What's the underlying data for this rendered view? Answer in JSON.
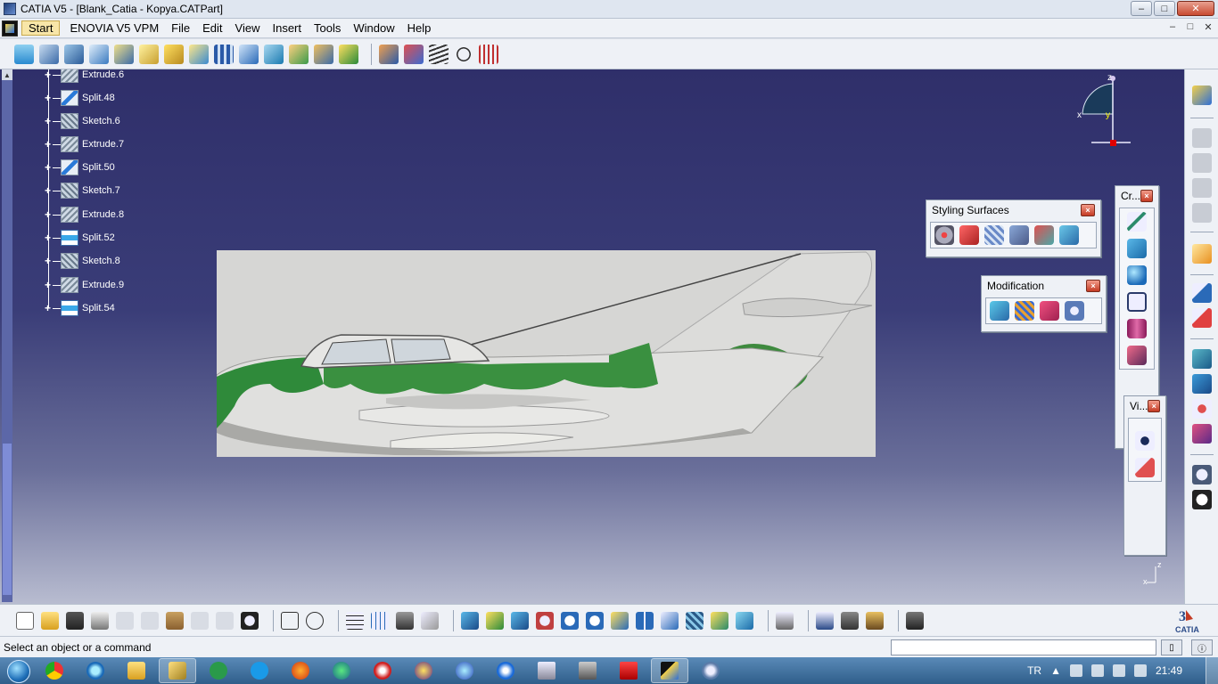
{
  "window": {
    "title": "CATIA V5 - [Blank_Catia - Kopya.CATPart]",
    "buttons": [
      "–",
      "□",
      "✕"
    ]
  },
  "menu": {
    "items": [
      "Start",
      "ENOVIA V5 VPM",
      "File",
      "Edit",
      "View",
      "Insert",
      "Tools",
      "Window",
      "Help"
    ],
    "mdi_buttons": [
      "–",
      "□",
      "✕"
    ]
  },
  "tree": {
    "items": [
      {
        "label": "Extrude.6",
        "icon": "extrude-icon"
      },
      {
        "label": "Split.48",
        "icon": "split-icon"
      },
      {
        "label": "Sketch.6",
        "icon": "sketch-icon"
      },
      {
        "label": "Extrude.7",
        "icon": "extrude-icon"
      },
      {
        "label": "Split.50",
        "icon": "split-icon"
      },
      {
        "label": "Sketch.7",
        "icon": "sketch-icon"
      },
      {
        "label": "Extrude.8",
        "icon": "extrude-icon"
      },
      {
        "label": "Split.52",
        "icon": "split-icon"
      },
      {
        "label": "Sketch.8",
        "icon": "sketch-icon"
      },
      {
        "label": "Extrude.9",
        "icon": "extrude-icon"
      },
      {
        "label": "Split.54",
        "icon": "split-icon"
      }
    ]
  },
  "compass": {
    "z_label": "z",
    "x_label": "x",
    "y_label": "y"
  },
  "triad": {
    "z_label": "z",
    "x_label": "x"
  },
  "toolbars": {
    "styling_surfaces": {
      "title": "Styling Surfaces",
      "close": "×"
    },
    "modification": {
      "title": "Modification",
      "close": "×"
    },
    "create": {
      "title": "Cr...",
      "close": "×"
    },
    "view": {
      "title": "Vi...",
      "close": "×"
    }
  },
  "status": {
    "message": "Select an object or a command",
    "command_input": ""
  },
  "taskbar": {
    "language": "TR",
    "time": "21:49"
  },
  "colors": {
    "viewport_top": "#2f2f6a",
    "viewport_bottom": "#b8bcd0",
    "camo_green": "#2f8a3a",
    "aircraft_silver": "#d9d9d9"
  }
}
